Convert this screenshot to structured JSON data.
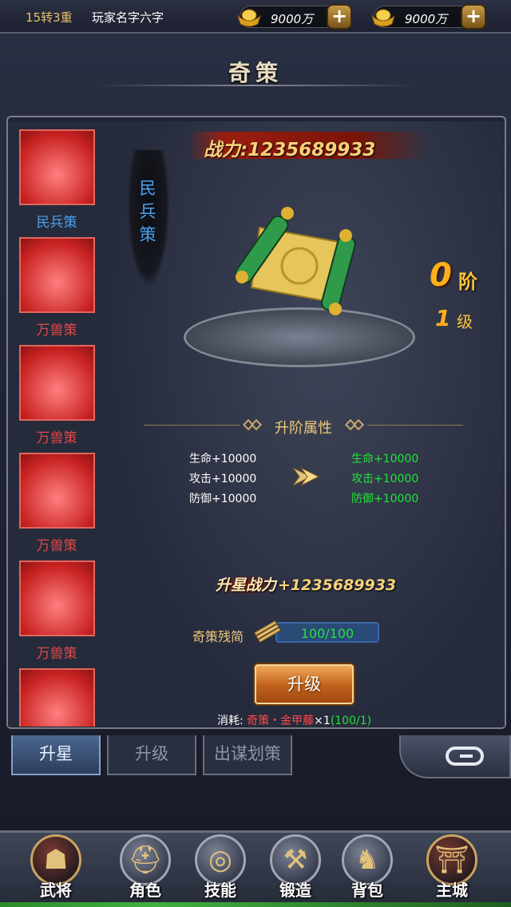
{
  "topbar": {
    "reincarnation": "15转3重",
    "player_name": "玩家名字六字",
    "currency1": {
      "value": "9000万",
      "add": "+",
      "icon": "gold-ingot-icon"
    },
    "currency2": {
      "value": "9000万",
      "add": "+",
      "icon": "gold-ingot-icon"
    }
  },
  "page_title": "奇策",
  "strategy_list": [
    {
      "label": "民兵策",
      "selected": true
    },
    {
      "label": "万兽策"
    },
    {
      "label": "万兽策"
    },
    {
      "label": "万兽策"
    },
    {
      "label": "万兽策"
    },
    {
      "label": ""
    }
  ],
  "detail": {
    "name": "民兵策",
    "power_label": "战力:",
    "power_value": "1235689933",
    "rank_value": "0",
    "rank_unit": "阶",
    "level_value": "1",
    "level_unit": "级"
  },
  "attributes": {
    "title": "升阶属性",
    "current": [
      "生命+10000",
      "攻击+10000",
      "防御+10000"
    ],
    "next": [
      "生命+10000",
      "攻击+10000",
      "防御+10000"
    ]
  },
  "upgrade": {
    "power_label": "升星战力",
    "power_value": "+1235689933",
    "material_label": "奇策残简",
    "material_progress": "100/100",
    "material_fraction": 1.0,
    "button_label": "升级",
    "cost_label": "消耗:",
    "cost_item": "奇策・金甲藤",
    "cost_qty": "×1",
    "cost_have": "(100/1)"
  },
  "tabs": [
    "升星",
    "升级",
    "出谋划策"
  ],
  "bottom_nav": [
    "武将",
    "角色",
    "技能",
    "锻造",
    "背包",
    "主城"
  ],
  "colors": {
    "selected_label": "#4aa0f0",
    "item_label": "#e04848",
    "positive": "#24e23a",
    "gold": "#f6d27a"
  }
}
